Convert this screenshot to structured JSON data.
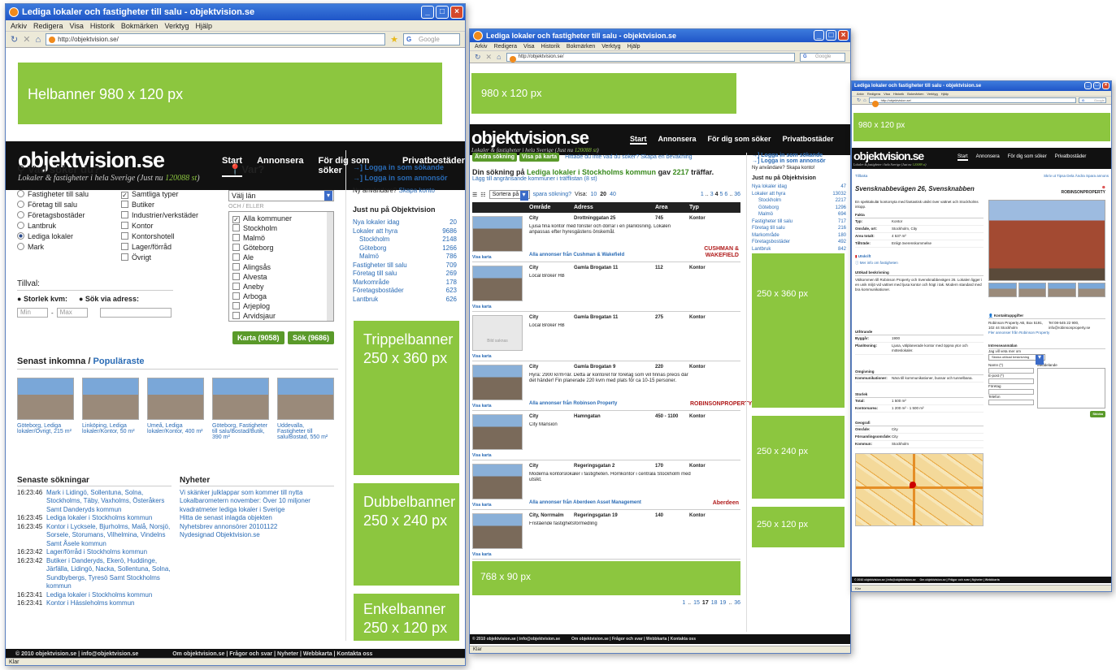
{
  "w1": {
    "title": "Lediga lokaler och fastigheter till salu - objektvision.se",
    "menu": [
      "Arkiv",
      "Redigera",
      "Visa",
      "Historik",
      "Bokmärken",
      "Verktyg",
      "Hjälp"
    ],
    "url": "http://objektvision.se/",
    "google": "Google",
    "top_banner": "Helbanner 980 x 120 px",
    "logo": "objektvision.se",
    "tagline_pre": "Lokaler & fastigheter i hela Sverige (Just nu ",
    "tagline_count": "120088 st",
    "tagline_post": ")",
    "nav": [
      "Start",
      "Annonsera",
      "För dig som söker",
      "Privatbostäder"
    ],
    "search_title": "Vad söker du?",
    "types_left": [
      "Fastigheter till salu",
      "Företag till salu",
      "Företagsbostäder",
      "Lantbruk",
      "Lediga lokaler",
      "Mark"
    ],
    "types_right": [
      "Samtliga typer",
      "Butiker",
      "Industrier/verkstäder",
      "Kontor",
      "Kontorshotell",
      "Lager/förråd",
      "Övrigt"
    ],
    "where_title": "Var?",
    "county_select": "Välj län",
    "or_label": "OCH / ELLER",
    "municipalities": [
      "Alla kommuner",
      "Stockholm",
      "Malmö",
      "Göteborg",
      "Ale",
      "Alingsås",
      "Alvesta",
      "Aneby",
      "Arboga",
      "Arjeplog",
      "Arvidsjaur"
    ],
    "tillval": "Tillval:",
    "size_label": "Storlek kvm:",
    "address_label": "Sök via adress:",
    "min": "Min",
    "max": "Max",
    "map_button": "Karta (9058)",
    "search_button": "Sök (9686)",
    "latest_title": "Senast inkomna",
    "popular_title": "Populäraste",
    "listings": [
      "Göteborg, Lediga lokaler/Övrigt, 215 m²",
      "Linköping, Lediga lokaler/Kontor, 50 m²",
      "Umeå, Lediga lokaler/Kontor, 400 m²",
      "Göteborg, Fastigheter till salu/Bostad/Butik, 390 m²",
      "Uddevalla, Fastigheter till salu/Bostad, 550 m²"
    ],
    "recent_title": "Senaste sökningar",
    "recent": [
      {
        "time": "16:23:46",
        "text": "Mark i Lidingö, Sollentuna, Solna, Stockholms, Täby, Vaxholms, Österåkers Samt Danderyds kommun"
      },
      {
        "time": "16:23:45",
        "text": "Lediga lokaler i Stockholms kommun"
      },
      {
        "time": "16:23:45",
        "text": "Kontor i Lycksele, Bjurholms, Malå, Norsjö, Sorsele, Storumans, Vilhelmina, Vindelns Samt Åsele kommun"
      },
      {
        "time": "16:23:42",
        "text": "Lager/förråd i Stockholms kommun"
      },
      {
        "time": "16:23:42",
        "text": "Butiker i Danderyds, Ekerö, Huddinge, Järfälla, Lidingö, Nacka, Sollentuna, Solna, Sundbybergs, Tyresö Samt Stockholms kommun"
      },
      {
        "time": "16:23:41",
        "text": "Lediga lokaler i Stockholms kommun"
      },
      {
        "time": "16:23:41",
        "text": "Kontor i Hässleholms kommun"
      }
    ],
    "news_title": "Nyheter",
    "news": [
      "Vi skänker julklappar som kommer till nytta",
      "Lokalbarometern november: Över 10 miljoner kvadratmeter lediga lokaler i Sverige",
      "Hitta de senast inlagda objekten",
      "Nyhetsbrev annonsörer 20101122",
      "Nydesignad Objektvision.se"
    ],
    "login_seeker": "Logga in som sökande",
    "login_advertiser": "Logga in som annonsör",
    "new_user": "Ny användare?",
    "create_account": "Skapa konto",
    "just_now": "Just nu på Objektvision",
    "stats": [
      {
        "label": "Nya lokaler idag",
        "value": "20",
        "sub": false
      },
      {
        "label": "Lokaler att hyra",
        "value": "9686",
        "sub": false
      },
      {
        "label": "Stockholm",
        "value": "2148",
        "sub": true
      },
      {
        "label": "Göteborg",
        "value": "1266",
        "sub": true
      },
      {
        "label": "Malmö",
        "value": "786",
        "sub": true
      },
      {
        "label": "Fastigheter till salu",
        "value": "709",
        "sub": false
      },
      {
        "label": "Företag till salu",
        "value": "269",
        "sub": false
      },
      {
        "label": "Markområde",
        "value": "178",
        "sub": false
      },
      {
        "label": "Företagsbostäder",
        "value": "623",
        "sub": false
      },
      {
        "label": "Lantbruk",
        "value": "626",
        "sub": false
      }
    ],
    "triple": "Trippelbanner 250 x 360 px",
    "double": "Dubbelbanner 250 x 240 px",
    "single": "Enkelbanner 250 x 120 px",
    "footer_left": "© 2010 objektvision.se | info@objektvision.se",
    "footer_links": "Om objektvision.se | Frågor och svar | Nyheter | Webbkarta | Kontakta oss",
    "status": "Klar"
  },
  "w2": {
    "title": "Lediga lokaler och fastigheter till salu - objektvision.se",
    "url": "http://objektvision.se/",
    "top_banner": "980 x 120 px",
    "logo": "objektvision.se",
    "tab_change": "Ändra sökning",
    "tab_map": "Visa på karta",
    "hint": "Hittade du inte vad du söker? Skapa en bevakning",
    "heading_pre": "Din sökning på ",
    "heading_link": "Lediga lokaler i Stockholms kommun",
    "heading_mid": " gav ",
    "heading_count": "2217",
    "heading_post": " träffar.",
    "sub_link": "Lägg till angränsande kommuner i träfflistan (8 st)",
    "sort": "Sortera på",
    "save": "spara sökning?",
    "show": "Visa:",
    "per_page": [
      "10",
      "20",
      "40"
    ],
    "pages_top": [
      "1",
      "3",
      "4",
      "5",
      "6",
      "36"
    ],
    "cols": [
      "Område",
      "Adress",
      "Area",
      "Typ"
    ],
    "results": [
      {
        "area": "City",
        "addr": "Drottninggatan 25",
        "size": "745",
        "type": "Kontor",
        "desc": "Ljusa fina kontor med fönster och dörrar i en planlösning. Lokalen anpassas efter hyresgästens önskemål.",
        "link": "Alla annonser från Cushman & Wakefield",
        "brand": "CUSHMAN & WAKEFIELD"
      },
      {
        "area": "City",
        "addr": "Gamla Brogatan 11",
        "size": "112",
        "type": "Kontor",
        "desc": "Local Broker HB",
        "link": "",
        "brand": ""
      },
      {
        "area": "City",
        "addr": "Gamla Brogatan 11",
        "size": "275",
        "type": "Kontor",
        "desc": "Local Broker HB",
        "link": "",
        "brand": "",
        "nopic": "Bild saknas"
      },
      {
        "area": "City",
        "addr": "Gamla Brogatan 9",
        "size": "220",
        "type": "Kontor",
        "desc": "Hyra: 2900 kr/m²/år. Detta är kontoret för företag som vill finnas precis där det händer! Fin planerade 220 kvm med plats för ca 10-15 personer.",
        "link": "Alla annonser från Robinson Property",
        "brand": "ROBINSONPROPERTY"
      },
      {
        "area": "City",
        "addr": "Hamngatan",
        "size": "450 - 1100",
        "type": "Kontor",
        "desc": "City Mansion",
        "link": "",
        "brand": ""
      },
      {
        "area": "City",
        "addr": "Regeringsgatan 2",
        "size": "170",
        "type": "Kontor",
        "desc": "Moderna kontorslokaler i fastigheten. Hörnkontor i centrala Stockholm med utsikt.",
        "link": "Alla annonser från Aberdeen Asset Management",
        "brand": "Aberdeen"
      },
      {
        "area": "City, Norrmalm",
        "addr": "Regeringsgatan 19",
        "size": "140",
        "type": "Kontor",
        "desc": "Fristående fastighetsförmedling",
        "link": "",
        "brand": ""
      }
    ],
    "show_link": "Visa karta",
    "login_seeker": "Logga in som sökande",
    "login_advertiser": "Logga in som annonsör",
    "new_user": "Ny användare? Skapa konto!",
    "just_now": "Just nu på Objektvision",
    "stats": [
      {
        "label": "Nya lokaler idag",
        "value": "47",
        "sub": false
      },
      {
        "label": "Lokaler att hyra",
        "value": "13032",
        "sub": false
      },
      {
        "label": "Stockholm",
        "value": "2217",
        "sub": true
      },
      {
        "label": "Göteborg",
        "value": "1296",
        "sub": true
      },
      {
        "label": "Malmö",
        "value": "694",
        "sub": true
      },
      {
        "label": "Fastigheter till salu",
        "value": "717",
        "sub": false
      },
      {
        "label": "Företag till salu",
        "value": "216",
        "sub": false
      },
      {
        "label": "Markområde",
        "value": "180",
        "sub": false
      },
      {
        "label": "Företagsbostäder",
        "value": "492",
        "sub": false
      },
      {
        "label": "Lantbruk",
        "value": "842",
        "sub": false
      }
    ],
    "b360": "250 x 360 px",
    "b240": "250 x 240 px",
    "b120": "250 x 120 px",
    "b768": "768 x 90 px",
    "pages_bottom": [
      "1",
      "15",
      "17",
      "18",
      "19",
      "36"
    ],
    "footer": "© 2010 objektvision.se | info@objektvision.se          Om objektvision.se | Frågor och svar | Webbkarta | Kontakta oss"
  },
  "w3": {
    "title": "Lediga lokaler och fastigheter till salu - objektvision.se",
    "url": "http://objektvision.se/",
    "top_banner": "980 x 120 px",
    "logo": "objektvision.se",
    "nav": [
      "Start",
      "Annonsera",
      "För dig som söker",
      "Privatbostäder"
    ],
    "back": "Tillbaka",
    "tools": "Skriv ut  Tipsa  Dela  Ändra  Spara annons",
    "heading": "Svensknabbevägen 26, Svensknabben",
    "brand": "ROBINSONPROPERTY",
    "intro": "En spektakulär kontorsyta med fantastisk utsikt över vattnet och Stockholms inlopp.",
    "facts_title": "Fakta",
    "facts": [
      [
        "Typ:",
        "Kontor"
      ],
      [
        "Område, ort:",
        "Stockholm, City"
      ],
      [
        "Area totalt:",
        "4 537 m²"
      ],
      [
        "Tillträde:",
        "Enligt överenskommelse"
      ]
    ],
    "print": "Utskrift",
    "more_info": "Mer info om fastigheten",
    "desc_title": "Utökad beskrivning",
    "desc": "Välkommen till Robinson Property och Svensknabbevägen 26. Lokalen ligger i en unik miljö vid vattnet med ljusa kontor och högt i tak. Modern standard med bra kommunikationer.",
    "equip_title": "Utförande",
    "equip": [
      [
        "Byggår:",
        "1900"
      ],
      [
        "Planlösning:",
        "Ljusa, välplanerade kontor med öppna ytor och möteslokaler."
      ]
    ],
    "loc_title": "Omgivning",
    "loc": [
      [
        "Kommunikationer:",
        "Nära till kommunikationer, bussar och tunnelbana."
      ]
    ],
    "size_title": "Storlek",
    "size": [
      [
        "Total:",
        "1 500 m²"
      ],
      [
        "Kontorsarea:",
        "1 200 m² - 1 500 m²"
      ]
    ],
    "geo_title": "Geografi",
    "geo": [
      [
        "Område:",
        "City"
      ],
      [
        "Församlingsområde:",
        "City"
      ],
      [
        "Kommun:",
        "Stockholm"
      ]
    ],
    "contact_title": "Kontaktuppgifter",
    "contact_left": "Robinson Property AB, Box 5191, 102 44 Stockholm",
    "contact_right": "Tel 08-545 22 900, info@robinsonproperty.se",
    "contact_link": "Fler annonser från Robinson Property",
    "interest_title": "Intresseanmälan",
    "interest_intro": "Jag vill veta mer om",
    "interest_select": "Skicka utökad beskrivning",
    "fields": [
      "Namn (*)",
      "E-post (*)",
      "Företag",
      "Telefon"
    ],
    "message": "Meddelande",
    "send": "Skicka",
    "footer": "© 2010 objektvision.se | info@objektvision.se     Om objektvision.se | Frågor och svar | Nyheter | Webbkarta"
  }
}
